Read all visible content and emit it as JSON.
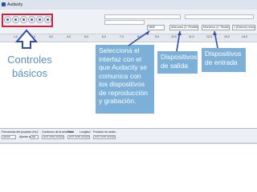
{
  "window": {
    "title": "Audacity"
  },
  "toolbar": {
    "buttons": [
      {
        "icon": "pause-icon"
      },
      {
        "icon": "play-icon"
      },
      {
        "icon": "stop-icon"
      },
      {
        "icon": "skip-start-icon"
      },
      {
        "icon": "skip-end-icon"
      },
      {
        "icon": "record-icon"
      }
    ],
    "host_select": "MME",
    "output_device": "Altavoces (2- Realtek High Definitio",
    "input_device": "Micrófono (2- Realtek High Defini",
    "channels": "2 (Estéreo) entra"
  },
  "ruler": {
    "ticks": [
      "1,0",
      "2,0",
      "3,0",
      "4,0",
      "5,0",
      "6,0",
      "7,0",
      "8,0",
      "9,0",
      "10,0",
      "11,0",
      "12,0",
      "13,0",
      "14,0"
    ]
  },
  "selection_toolbar": {
    "project_rate_label": "Frecuencia del proyecto (Hz):",
    "project_rate_value": "44100",
    "snap_label": "Ajustar a",
    "snap_value": "No",
    "selection_start_label": "Comienzo de la selección",
    "selection_start_value": "00 h 00 m 00,000 s",
    "end_label": "Final",
    "length_label": "Longitud",
    "end_value": "00 h 00 m 00,000 s",
    "audio_position_label": "Posición de audio:",
    "audio_position_value": "00 h 00 m 00,000 s"
  },
  "annotations": {
    "controles_basicos": "Controles básicos",
    "selecciona_interfaz": "Selecciona el interfaz con el que Audacity se comunica con los dispositivos de reproducción y grabación.",
    "dispositivos_salida": "Dispositivos de salida",
    "dispositivos_entrada": "Dispositivos de entrada"
  },
  "colors": {
    "callout_bg": "#7db0d8",
    "arrow": "#2d4fa8",
    "highlight_box": "#d4203a",
    "label_text": "#5b8ec4"
  }
}
